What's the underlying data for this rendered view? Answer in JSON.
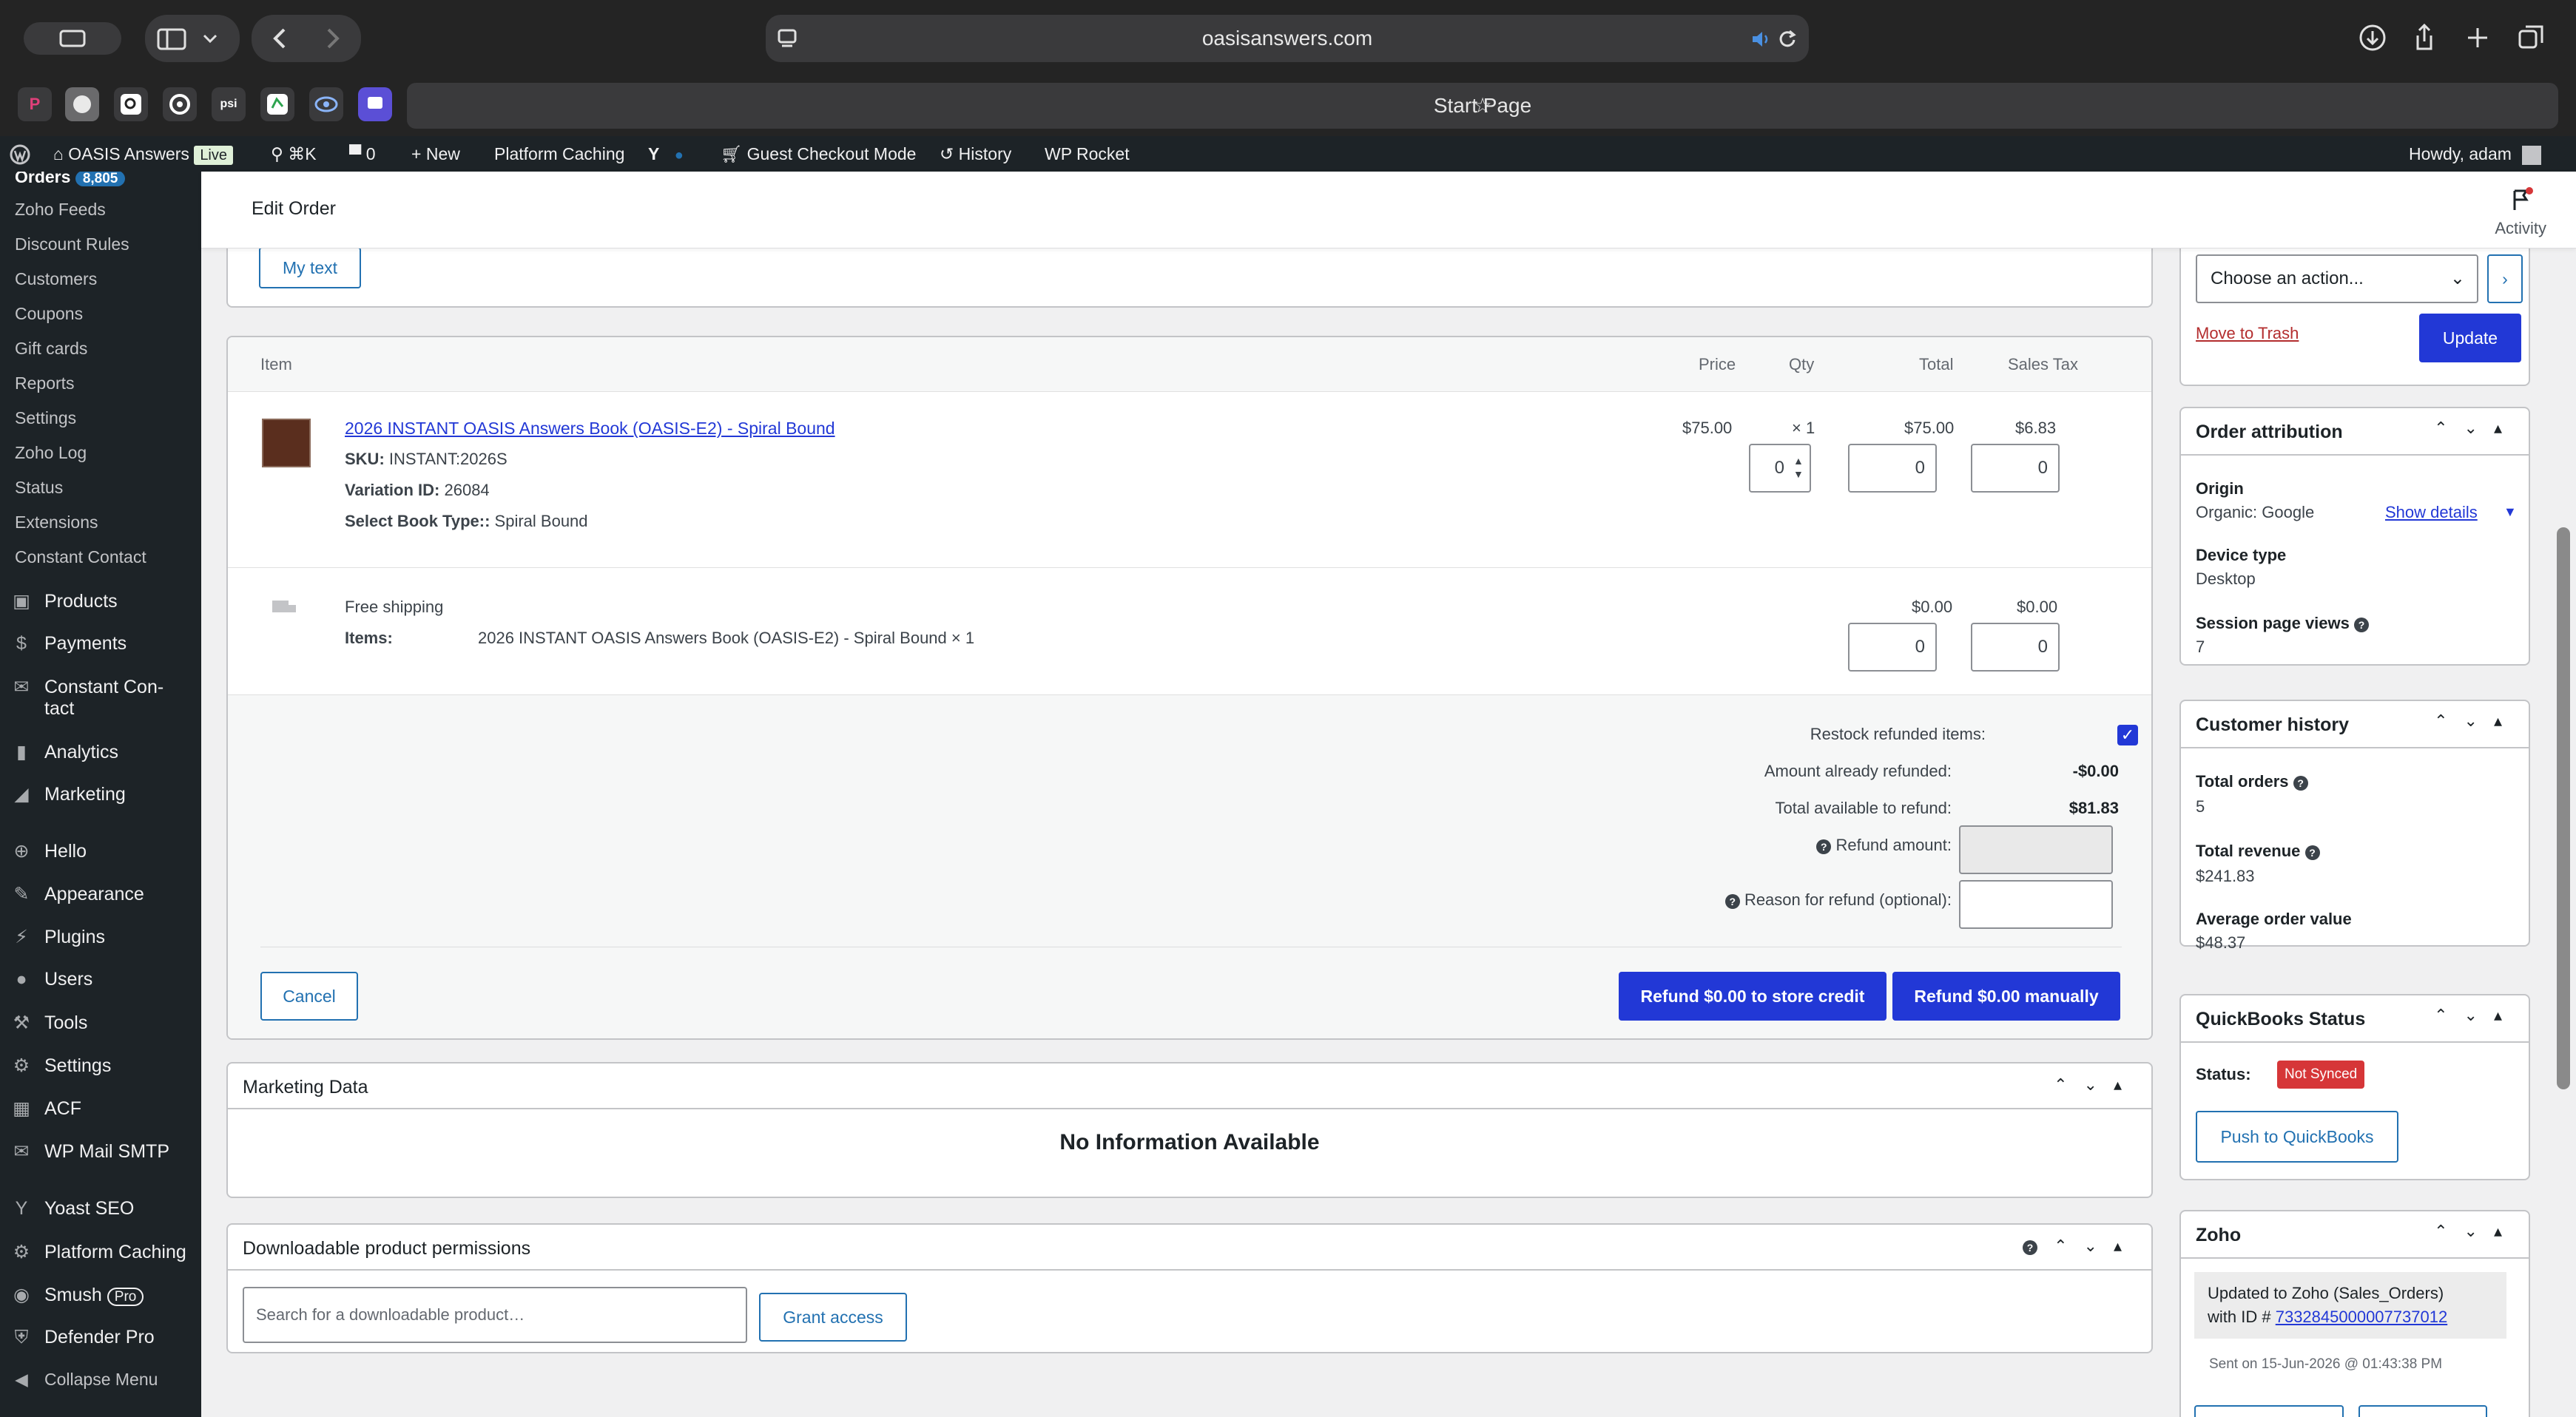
{
  "browser": {
    "url": "oasisanswers.com",
    "tab_title": "Start Page",
    "favicons": [
      "P",
      "",
      "",
      "",
      "psi",
      "",
      "",
      ""
    ]
  },
  "adminbar": {
    "site_name": "OASIS Answers",
    "live_badge": "Live",
    "search_shortcut": "⌘K",
    "comments_count": "0",
    "new_label": "New",
    "platform_caching": "Platform Caching",
    "guest_checkout": "Guest Checkout Mode",
    "history": "History",
    "wp_rocket": "WP Rocket",
    "howdy": "Howdy, adam"
  },
  "sidebar": {
    "orders_label": "Orders",
    "orders_badge": "8,805",
    "submenu": [
      "Zoho Feeds",
      "Discount Rules",
      "Customers",
      "Coupons",
      "Gift cards",
      "Reports",
      "Settings",
      "Zoho Log",
      "Status",
      "Extensions",
      "Constant Contact"
    ],
    "menu": {
      "products": "Products",
      "payments": "Payments",
      "constant_contact_1": "Constant Con-",
      "constant_contact_2": "tact",
      "analytics": "Analytics",
      "marketing": "Marketing",
      "hello": "Hello",
      "appearance": "Appearance",
      "plugins": "Plugins",
      "users": "Users",
      "tools": "Tools",
      "settings": "Settings",
      "acf": "ACF",
      "wp_mail_smtp": "WP Mail SMTP",
      "yoast": "Yoast SEO",
      "platform_caching": "Platform Caching",
      "smush": "Smush",
      "smush_pro": "Pro",
      "defender": "Defender Pro",
      "collapse": "Collapse Menu"
    }
  },
  "header": {
    "title": "Edit Order",
    "activity": "Activity"
  },
  "top_box": {
    "my_text_button": "My text"
  },
  "items_table": {
    "headers": {
      "item": "Item",
      "price": "Price",
      "qty": "Qty",
      "total": "Total",
      "tax": "Sales Tax"
    },
    "product": {
      "name": "2026 INSTANT OASIS Answers Book (OASIS-E2) - Spiral Bound",
      "sku_label": "SKU:",
      "sku": "INSTANT:2026S",
      "variation_label": "Variation ID:",
      "variation": "26084",
      "book_type_label": "Select Book Type::",
      "book_type": "Spiral Bound",
      "price": "$75.00",
      "qty": "× 1",
      "total": "$75.00",
      "tax": "$6.83",
      "refund_qty": "0",
      "refund_total": "0",
      "refund_tax": "0"
    },
    "shipping": {
      "name": "Free shipping",
      "items_label": "Items:",
      "items": "2026 INSTANT OASIS Answers Book (OASIS-E2) - Spiral Bound × 1",
      "total": "$0.00",
      "tax": "$0.00",
      "refund_total": "0",
      "refund_tax": "0"
    }
  },
  "refund": {
    "restock_label": "Restock refunded items:",
    "already_label": "Amount already refunded:",
    "already_value": "-$0.00",
    "available_label": "Total available to refund:",
    "available_value": "$81.83",
    "amount_label": "Refund amount:",
    "reason_label": "Reason for refund (optional):",
    "cancel": "Cancel",
    "store_credit": "Refund $0.00 to store credit",
    "manually": "Refund $0.00 manually"
  },
  "marketing": {
    "title": "Marketing Data",
    "empty": "No Information Available"
  },
  "downloads": {
    "title": "Downloadable product permissions",
    "search_placeholder": "Search for a downloadable product…",
    "grant": "Grant access"
  },
  "actions": {
    "select_value": "Choose an action...",
    "trash": "Move to Trash",
    "update": "Update"
  },
  "attribution": {
    "title": "Order attribution",
    "origin_label": "Origin",
    "origin_value": "Organic: Google",
    "show_details": "Show details",
    "device_label": "Device type",
    "device_value": "Desktop",
    "views_label": "Session page views",
    "views_value": "7"
  },
  "customer_history": {
    "title": "Customer history",
    "orders_label": "Total orders",
    "orders_value": "5",
    "revenue_label": "Total revenue",
    "revenue_value": "$241.83",
    "aov_label": "Average order value",
    "aov_value": "$48.37"
  },
  "quickbooks": {
    "title": "QuickBooks Status",
    "status_label": "Status:",
    "status_value": "Not Synced",
    "push": "Push to QuickBooks"
  },
  "zoho": {
    "title": "Zoho",
    "note_line1": "Updated to Zoho (Sales_Orders)",
    "note_line2": "with ID #",
    "note_id": "7332845000007737012",
    "sent": "Sent on 15-Jun-2026 @ 01:43:38 PM"
  }
}
